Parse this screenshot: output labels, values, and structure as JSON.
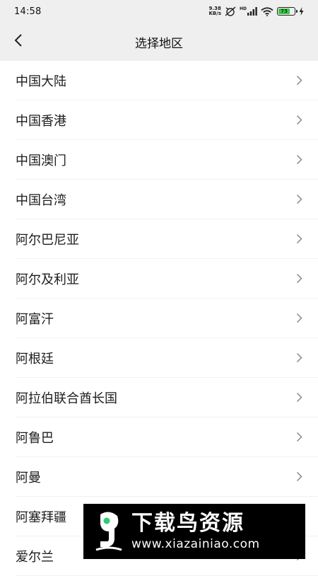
{
  "status_bar": {
    "time": "14:58",
    "net_speed_value": "9.38",
    "net_speed_unit": "KB/s",
    "signal_label": "HD",
    "battery_level": "73",
    "battery_percent": 73
  },
  "header": {
    "title": "选择地区",
    "back_icon": "chevron-left-icon"
  },
  "regions": [
    "中国大陆",
    "中国香港",
    "中国澳门",
    "中国台湾",
    "阿尔巴尼亚",
    "阿尔及利亚",
    "阿富汗",
    "阿根廷",
    "阿拉伯联合酋长国",
    "阿鲁巴",
    "阿曼",
    "阿塞拜疆",
    "爱尔兰"
  ],
  "watermark": {
    "title": "下载鸟资源",
    "url": "www.xiazainiao.com"
  },
  "colors": {
    "header_bg": "#efefef",
    "battery": "#3ec74d",
    "watermark_bg": "#000000",
    "logo_accent": "#2ecc71"
  }
}
